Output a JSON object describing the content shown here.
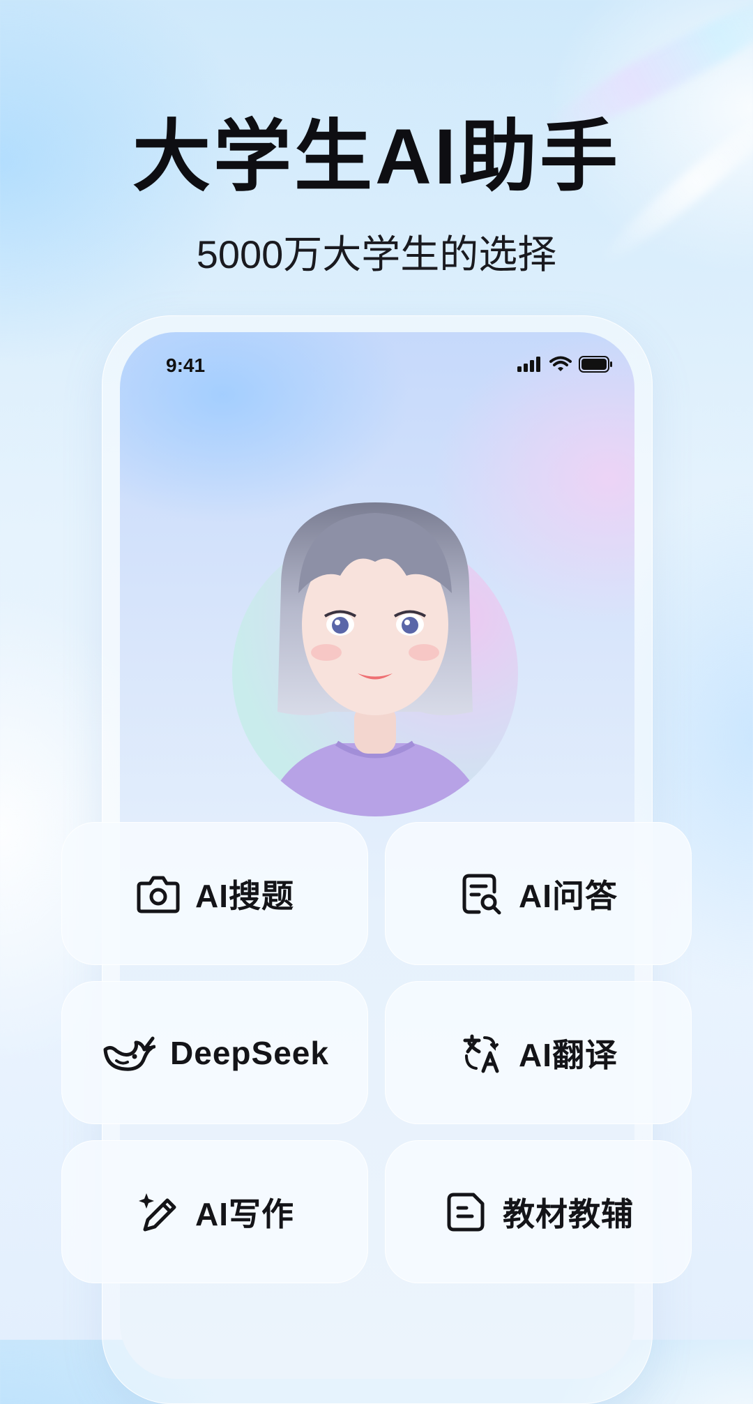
{
  "hero": {
    "title": "大学生AI助手",
    "subtitle": "5000万大学生的选择"
  },
  "phone": {
    "status_time": "9:41",
    "status_icons": [
      "cellular-signal-icon",
      "wifi-icon",
      "battery-icon"
    ]
  },
  "features": [
    {
      "label": "AI搜题",
      "icon": "camera-icon"
    },
    {
      "label": "AI问答",
      "icon": "document-search-icon"
    },
    {
      "label": "DeepSeek",
      "icon": "whale-icon"
    },
    {
      "label": "AI翻译",
      "icon": "translate-icon"
    },
    {
      "label": "AI写作",
      "icon": "sparkle-pen-icon"
    },
    {
      "label": "教材教辅",
      "icon": "notes-icon"
    }
  ],
  "colors": {
    "text_primary": "#141418",
    "background": "#e6f3fd",
    "avatar_shirt": "#b7a2e6"
  }
}
